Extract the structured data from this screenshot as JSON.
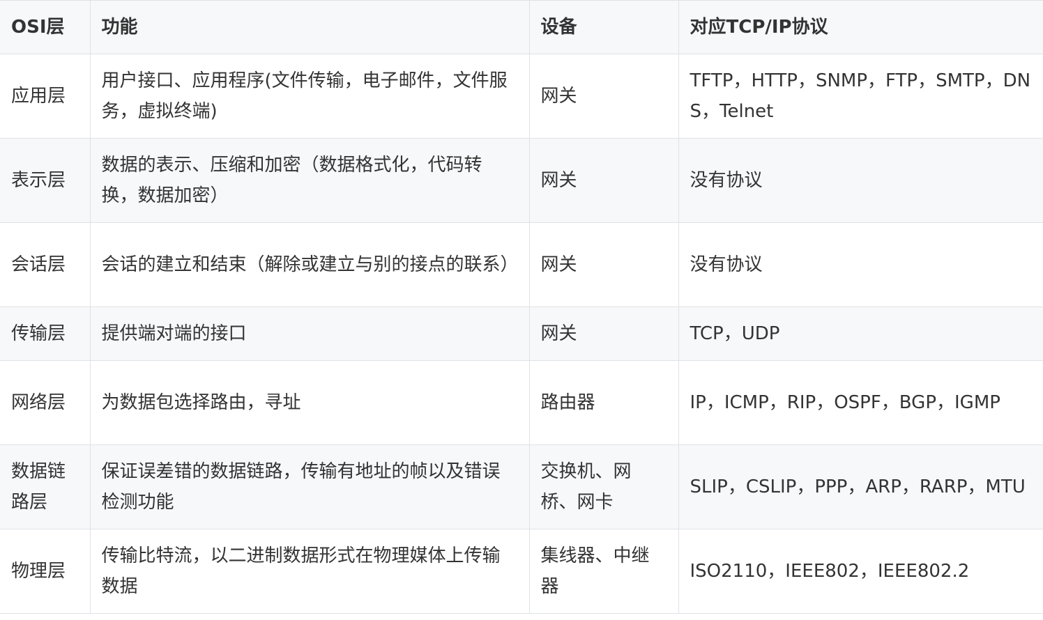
{
  "table": {
    "headers": [
      "OSI层",
      "功能",
      "设备",
      "对应TCP/IP协议"
    ],
    "rows": [
      [
        "应用层",
        "用户接口、应用程序(文件传输，电子邮件，文件服务，虚拟终端)",
        "网关",
        "TFTP，HTTP，SNMP，FTP，SMTP，DNS，Telnet"
      ],
      [
        "表示层",
        "数据的表示、压缩和加密（数据格式化，代码转换，数据加密）",
        "网关",
        "没有协议"
      ],
      [
        "会话层",
        "会话的建立和结束（解除或建立与别的接点的联系）",
        "网关",
        "没有协议"
      ],
      [
        "传输层",
        "提供端对端的接口",
        "网关",
        "TCP，UDP"
      ],
      [
        "网络层",
        "为数据包选择路由，寻址",
        "路由器",
        "IP，ICMP，RIP，OSPF，BGP，IGMP"
      ],
      [
        "数据链路层",
        "保证误差错的数据链路，传输有地址的帧以及错误检测功能",
        "交换机、网桥、网卡",
        "SLIP，CSLIP，PPP，ARP，RARP，MTU"
      ],
      [
        "物理层",
        "传输比特流，以二进制数据形式在物理媒体上传输数据",
        "集线器、中继器",
        "ISO2110，IEEE802，IEEE802.2"
      ]
    ]
  }
}
